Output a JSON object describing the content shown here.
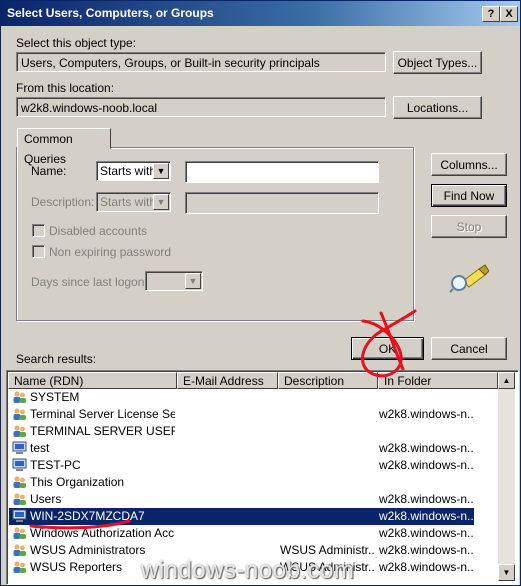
{
  "window": {
    "title": "Select Users, Computers, or Groups",
    "help_label": "?",
    "close_label": "X"
  },
  "object_type": {
    "label": "Select this object type:",
    "value": "Users, Computers, Groups, or Built-in security principals",
    "button": "Object Types..."
  },
  "location": {
    "label": "From this location:",
    "value": "w2k8.windows-noob.local",
    "button": "Locations..."
  },
  "common_queries": {
    "tab_label": "Common Queries",
    "name_label": "Name:",
    "name_mode": "Starts with",
    "name_value": "",
    "description_label": "Description:",
    "description_mode": "Starts with",
    "disabled_accounts_label": "Disabled accounts",
    "non_expiring_label": "Non expiring password",
    "days_label": "Days since last logon:"
  },
  "buttons": {
    "columns": "Columns...",
    "find_now": "Find Now",
    "stop": "Stop",
    "ok": "OK",
    "cancel": "Cancel"
  },
  "results": {
    "label": "Search results:",
    "columns": [
      "Name (RDN)",
      "E-Mail Address",
      "Description",
      "In Folder"
    ],
    "rows": [
      {
        "icon": "users-icon",
        "name": "SYSTEM",
        "email": "",
        "description": "",
        "folder": ""
      },
      {
        "icon": "users-icon",
        "name": "Terminal Server License Ser...",
        "email": "",
        "description": "",
        "folder": "w2k8.windows-n..."
      },
      {
        "icon": "users-icon",
        "name": "TERMINAL SERVER USER",
        "email": "",
        "description": "",
        "folder": ""
      },
      {
        "icon": "computer-icon",
        "name": "test",
        "email": "",
        "description": "",
        "folder": "w2k8.windows-n..."
      },
      {
        "icon": "computer-icon",
        "name": "TEST-PC",
        "email": "",
        "description": "",
        "folder": "w2k8.windows-n..."
      },
      {
        "icon": "users-icon",
        "name": "This Organization",
        "email": "",
        "description": "",
        "folder": ""
      },
      {
        "icon": "users-icon",
        "name": "Users",
        "email": "",
        "description": "",
        "folder": "w2k8.windows-n..."
      },
      {
        "icon": "computer-icon",
        "name": "WIN-2SDX7MZCDA7",
        "email": "",
        "description": "",
        "folder": "w2k8.windows-n...",
        "selected": true
      },
      {
        "icon": "users-icon",
        "name": "Windows Authorization Acc...",
        "email": "",
        "description": "",
        "folder": "w2k8.windows-n..."
      },
      {
        "icon": "users-icon",
        "name": "WSUS Administrators",
        "email": "",
        "description": "WSUS Administr...",
        "folder": "w2k8.windows-n..."
      },
      {
        "icon": "users-icon",
        "name": "WSUS Reporters",
        "email": "",
        "description": "WSUS Administr...",
        "folder": "w2k8.windows-n..."
      }
    ]
  },
  "watermark": "windows-noob.com",
  "colors": {
    "title_start": "#0a246a",
    "title_end": "#a6caf0",
    "face": "#d4d0c8",
    "selection": "#0a246a",
    "annotation_red": "#e8101a"
  }
}
